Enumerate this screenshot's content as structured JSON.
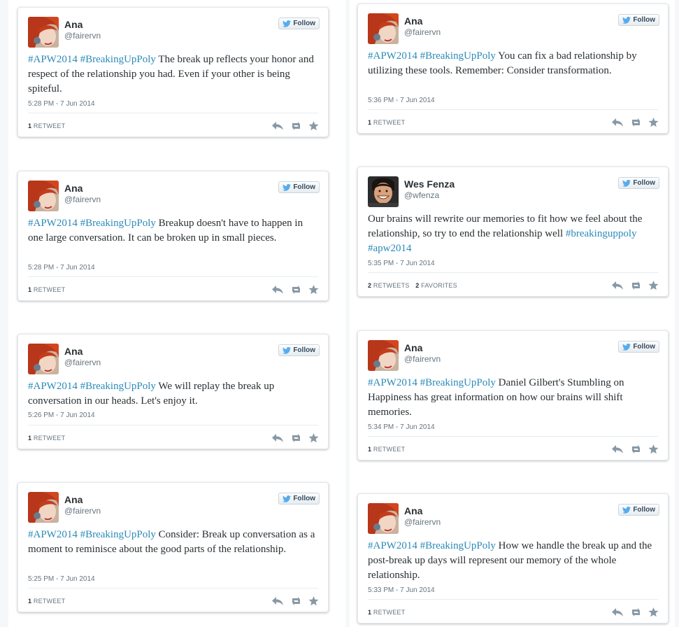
{
  "colors": {
    "link": "#2a8ab8",
    "twitter_bird": "#55acee",
    "icon_gray": "#8899a6"
  },
  "follow_label": "Follow",
  "tweets": [
    {
      "name": "Ana",
      "handle": "@fairervn",
      "avatar": "red-hair-avatar",
      "hashtags": [
        "#APW2014",
        "#BreakingUpPoly"
      ],
      "text": "The break up reflects your honor and respect of the relationship you had. Even if your other is being spiteful.",
      "time": "5:28 PM - 7 Jun 2014",
      "retweets": "1",
      "retweets_label": "RETWEET",
      "favorites": "",
      "favorites_label": ""
    },
    {
      "name": "Ana",
      "handle": "@fairervn",
      "avatar": "red-hair-avatar",
      "hashtags": [
        "#APW2014",
        "#BreakingUpPoly"
      ],
      "text": "You can fix a bad relationship by utilizing these tools. Remember: Consider transformation.",
      "time": "5:36 PM - 7 Jun 2014",
      "retweets": "1",
      "retweets_label": "RETWEET",
      "favorites": "",
      "favorites_label": ""
    },
    {
      "name": "Ana",
      "handle": "@fairervn",
      "avatar": "red-hair-avatar",
      "hashtags": [
        "#APW2014",
        "#BreakingUpPoly"
      ],
      "text": "Breakup doesn't have to happen in one large conversation. It can be broken up in small pieces.",
      "time": "5:28 PM - 7 Jun 2014",
      "retweets": "1",
      "retweets_label": "RETWEET",
      "favorites": "",
      "favorites_label": ""
    },
    {
      "name": "Wes Fenza",
      "handle": "@wfenza",
      "avatar": "smiling-man-avatar",
      "hashtags": [],
      "text": "Our brains will rewrite our memories to fit how we feel about the relationship, so try to end the relationship well",
      "trailing_hashtags": [
        "#breakinguppoly",
        "#apw2014"
      ],
      "time": "5:35 PM - 7 Jun 2014",
      "retweets": "2",
      "retweets_label": "RETWEETS",
      "favorites": "2",
      "favorites_label": "FAVORITES"
    },
    {
      "name": "Ana",
      "handle": "@fairervn",
      "avatar": "red-hair-avatar",
      "hashtags": [
        "#APW2014",
        "#BreakingUpPoly"
      ],
      "text": "We will replay the break up conversation in our heads. Let's enjoy it.",
      "time": "5:26 PM - 7 Jun 2014",
      "retweets": "1",
      "retweets_label": "RETWEET",
      "favorites": "",
      "favorites_label": ""
    },
    {
      "name": "Ana",
      "handle": "@fairervn",
      "avatar": "red-hair-avatar",
      "hashtags": [
        "#APW2014",
        "#BreakingUpPoly"
      ],
      "text": "Daniel Gilbert's Stumbling on Happiness has great information on how our brains will shift memories.",
      "time": "5:34 PM - 7 Jun 2014",
      "retweets": "1",
      "retweets_label": "RETWEET",
      "favorites": "",
      "favorites_label": ""
    },
    {
      "name": "Ana",
      "handle": "@fairervn",
      "avatar": "red-hair-avatar",
      "hashtags": [
        "#APW2014",
        "#BreakingUpPoly"
      ],
      "text": "Consider: Break up conversation as a moment to reminisce about the good parts of the relationship.",
      "time": "5:25 PM - 7 Jun 2014",
      "retweets": "1",
      "retweets_label": "RETWEET",
      "favorites": "",
      "favorites_label": ""
    },
    {
      "name": "Ana",
      "handle": "@fairervn",
      "avatar": "red-hair-avatar",
      "hashtags": [
        "#APW2014",
        "#BreakingUpPoly"
      ],
      "text": "How we handle the break up and the post-break up days will represent our memory of the whole relationship.",
      "time": "5:33 PM - 7 Jun 2014",
      "retweets": "1",
      "retweets_label": "RETWEET",
      "favorites": "",
      "favorites_label": ""
    }
  ]
}
